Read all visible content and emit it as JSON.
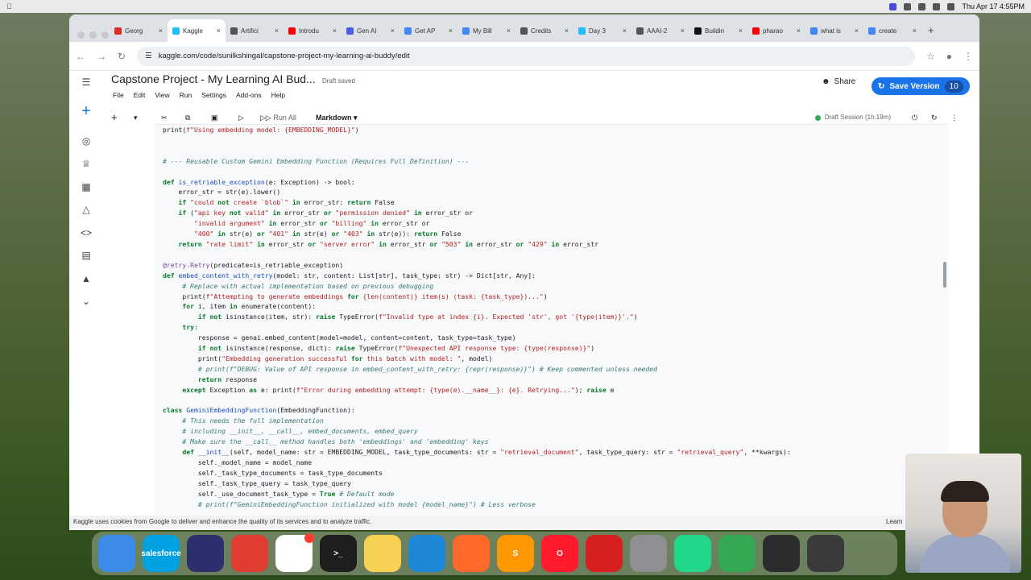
{
  "menubar": {
    "datetime": "Thu Apr 17  4:55PM"
  },
  "tabs": [
    {
      "label": "Georg",
      "color": "#d93025"
    },
    {
      "label": "Kaggle",
      "color": "#20beff",
      "active": true
    },
    {
      "label": "Artifici",
      "color": "#555"
    },
    {
      "label": "Introdu",
      "color": "#ff0000"
    },
    {
      "label": "Gen AI",
      "color": "#4a5de4"
    },
    {
      "label": "Get AP",
      "color": "#4285f4"
    },
    {
      "label": "My Bill",
      "color": "#4285f4"
    },
    {
      "label": "Credits",
      "color": "#555"
    },
    {
      "label": "Day 3",
      "color": "#20beff"
    },
    {
      "label": "AAAI-2",
      "color": "#555"
    },
    {
      "label": "Buildin",
      "color": "#111"
    },
    {
      "label": "pharao",
      "color": "#ff0000"
    },
    {
      "label": "what is",
      "color": "#4285f4"
    },
    {
      "label": "create",
      "color": "#4285f4"
    }
  ],
  "url": "kaggle.com/code/sunilkshingal/capstone-project-my-learning-ai-buddy/edit",
  "notebook": {
    "title": "Capstone Project - My Learning AI Bud...",
    "status": "Draft saved",
    "menus": [
      "File",
      "Edit",
      "View",
      "Run",
      "Settings",
      "Add-ons",
      "Help"
    ],
    "share": "Share",
    "save_version": "Save Version",
    "version_count": "10",
    "run_all": "Run All",
    "cell_type": "Markdown",
    "session": "Draft Session (1h:19m)"
  },
  "code_lines": [
    "print(f\"Using embedding model: {EMBEDDING_MODEL}\")",
    "",
    "",
    "# --- Reusable Custom Gemini Embedding Function (Requires Full Definition) ---",
    "",
    "def is_retriable_exception(e: Exception) -> bool:",
    "    error_str = str(e).lower()",
    "    if \"could not create `blob`\" in error_str: return False",
    "    if (\"api key not valid\" in error_str or \"permission denied\" in error_str or",
    "        \"invalid argument\" in error_str or \"billing\" in error_str or",
    "        \"400\" in str(e) or \"401\" in str(e) or \"403\" in str(e)): return False",
    "    return \"rate limit\" in error_str or \"server error\" in error_str or \"503\" in error_str or \"429\" in error_str",
    "",
    "@retry.Retry(predicate=is_retriable_exception)",
    "def embed_content_with_retry(model: str, content: List[str], task_type: str) -> Dict[str, Any]:",
    "     # Replace with actual implementation based on previous debugging",
    "     print(f\"Attempting to generate embeddings for {len(content)} item(s) (task: {task_type})...\")",
    "     for i, item in enumerate(content):",
    "         if not isinstance(item, str): raise TypeError(f\"Invalid type at index {i}. Expected 'str', got '{type(item)}'.\")",
    "     try:",
    "         response = genai.embed_content(model=model, content=content, task_type=task_type)",
    "         if not isinstance(response, dict): raise TypeError(f\"Unexpected API response type: {type(response)}\")",
    "         print(\"Embedding generation successful for this batch with model: \", model)",
    "         # print(f\"DEBUG: Value of API response in embed_content_with_retry: {repr(response)}\") # Keep commented unless needed",
    "         return response",
    "     except Exception as e: print(f\"Error during embedding attempt: {type(e).__name__}: {e}. Retrying...\"); raise e",
    "",
    "class GeminiEmbeddingFunction(EmbeddingFunction):",
    "     # This needs the full implementation",
    "     # including __init__, __call__, embed_documents, embed_query",
    "     # Make sure the __call__ method handles both 'embeddings' and 'embedding' keys",
    "     def __init__(self, model_name: str = EMBEDDING_MODEL, task_type_documents: str = \"retrieval_document\", task_type_query: str = \"retrieval_query\", **kwargs):",
    "         self._model_name = model_name",
    "         self._task_type_documents = task_type_documents",
    "         self._task_type_query = task_type_query",
    "         self._use_document_task_type = True # Default mode",
    "         # print(f\"GeminiEmbeddingFunction initialized with model {model_name}\") # Less verbose"
  ],
  "cookie_text": "Kaggle uses cookies from Google to deliver and enhance the quality of its services and to analyze traffic.",
  "cookie_learn": "Learn",
  "dock": [
    {
      "name": "finder",
      "color": "#3d8de8",
      "label": ""
    },
    {
      "name": "salesforce",
      "color": "#00a1e0",
      "label": "salesforce"
    },
    {
      "name": "messenger",
      "color": "#2b2f6b",
      "label": ""
    },
    {
      "name": "phone-mirror",
      "color": "#e03c31",
      "label": ""
    },
    {
      "name": "slack",
      "color": "#ffffff",
      "label": ""
    },
    {
      "name": "terminal",
      "color": "#1e1e1e",
      "label": ">_"
    },
    {
      "name": "notes",
      "color": "#f7d154",
      "label": ""
    },
    {
      "name": "vscode",
      "color": "#1e88d8",
      "label": ""
    },
    {
      "name": "pencil",
      "color": "#ff6a2b",
      "label": ""
    },
    {
      "name": "sublime",
      "color": "#ff9800",
      "label": "S"
    },
    {
      "name": "opera",
      "color": "#ff1b2d",
      "label": "O"
    },
    {
      "name": "acrobat",
      "color": "#d71f1f",
      "label": ""
    },
    {
      "name": "system-settings",
      "color": "#8e8e93",
      "label": ""
    },
    {
      "name": "pycharm",
      "color": "#21d789",
      "label": ""
    },
    {
      "name": "chrome",
      "color": "#34a853",
      "label": ""
    },
    {
      "name": "screen-tool",
      "color": "#2c2c2e",
      "label": ""
    },
    {
      "name": "app-switcher",
      "color": "#3a3a3c",
      "label": ""
    }
  ]
}
